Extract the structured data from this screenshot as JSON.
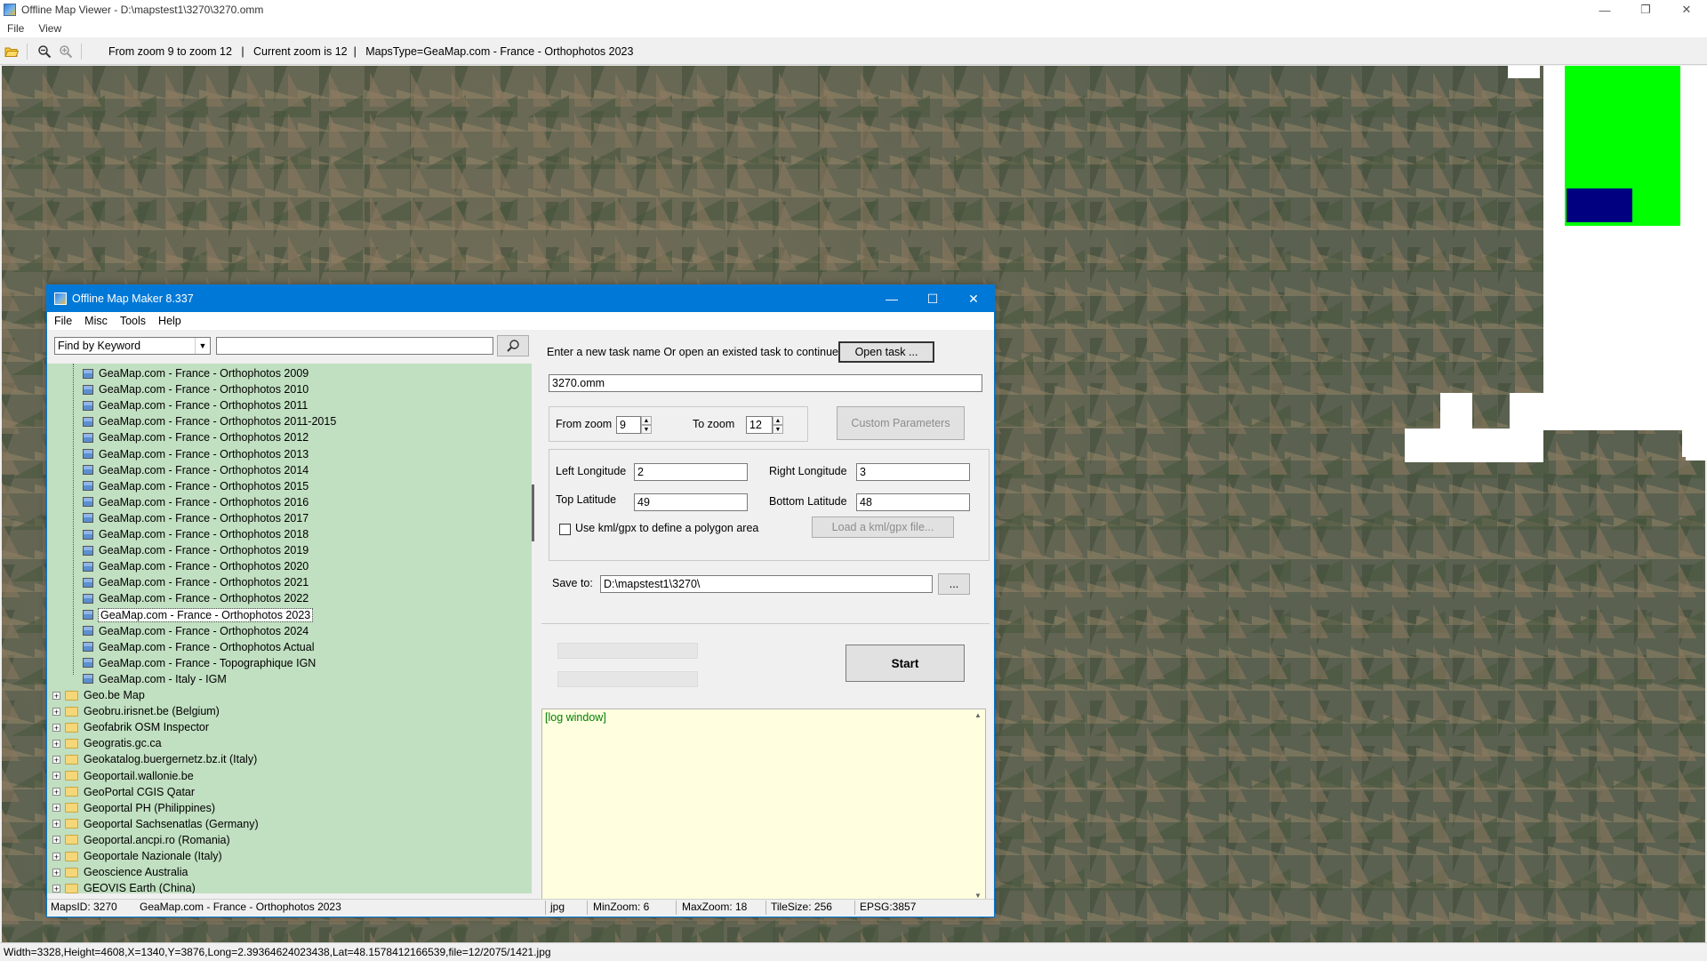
{
  "window": {
    "title": "Offline Map Viewer - D:\\mapstest1\\3270\\3270.omm",
    "controls": [
      "—",
      "❐",
      "✕"
    ]
  },
  "menubar": [
    "File",
    "View"
  ],
  "toolbar": {
    "info": "From zoom 9 to zoom 12   |   Current zoom is 12  |   MapsType=GeaMap.com - France - Orthophotos 2023",
    "icons": [
      "open-folder-icon",
      "zoom-out-icon",
      "zoom-in-icon"
    ]
  },
  "map": {
    "overlay_colors": {
      "tile_white": "#ffffff",
      "green_box": "#00ff00",
      "navy_box": "#000080"
    }
  },
  "status": {
    "text": "Width=3328,Height=4608,X=1340,Y=3876,Long=2.39364624023438,Lat=48.1578412166539,file=12/2075/1421.jpg"
  },
  "dialog": {
    "title": "Offline Map Maker 8.337",
    "menu": [
      "File",
      "Misc",
      "Tools",
      "Help"
    ],
    "search": {
      "mode": "Find by Keyword",
      "query": "",
      "button_icon": "search-icon"
    },
    "tree": {
      "leaves": [
        "GeaMap.com - France - Orthophotos 2009",
        "GeaMap.com - France - Orthophotos 2010",
        "GeaMap.com - France - Orthophotos 2011",
        "GeaMap.com - France - Orthophotos 2011-2015",
        "GeaMap.com - France - Orthophotos 2012",
        "GeaMap.com - France - Orthophotos 2013",
        "GeaMap.com - France - Orthophotos 2014",
        "GeaMap.com - France - Orthophotos 2015",
        "GeaMap.com - France - Orthophotos 2016",
        "GeaMap.com - France - Orthophotos 2017",
        "GeaMap.com - France - Orthophotos 2018",
        "GeaMap.com - France - Orthophotos 2019",
        "GeaMap.com - France - Orthophotos 2020",
        "GeaMap.com - France - Orthophotos 2021",
        "GeaMap.com - France - Orthophotos 2022",
        "GeaMap.com - France - Orthophotos 2023",
        "GeaMap.com - France - Orthophotos 2024",
        "GeaMap.com - France - Orthophotos Actual",
        "GeaMap.com - France - Topographique IGN",
        "GeaMap.com - Italy - IGM"
      ],
      "selected": "GeaMap.com - France - Orthophotos 2023",
      "folders": [
        "Geo.be Map",
        "Geobru.irisnet.be (Belgium)",
        "Geofabrik OSM Inspector",
        "Geogratis.gc.ca",
        "Geokatalog.buergernetz.bz.it (Italy)",
        "Geoportail.wallonie.be",
        "GeoPortal CGIS Qatar",
        "Geoportal PH (Philippines)",
        "Geoportal Sachsenatlas (Germany)",
        "Geoportal.ancpi.ro (Romania)",
        "Geoportale Nazionale (Italy)",
        "Geoscience Australia",
        "GEOVIS Earth (China)"
      ]
    },
    "task": {
      "prompt": "Enter a new task name Or open an existed task to continue:",
      "open_button": "Open task ...",
      "name": "3270.omm"
    },
    "zoom": {
      "from_label": "From zoom",
      "from_value": "9",
      "to_label": "To zoom",
      "to_value": "12",
      "custom_button": "Custom Parameters"
    },
    "bounds": {
      "left_lon_label": "Left Longitude",
      "left_lon": "2",
      "right_lon_label": "Right Longitude",
      "right_lon": "3",
      "top_lat_label": "Top Latitude",
      "top_lat": "49",
      "bottom_lat_label": "Bottom Latitude",
      "bottom_lat": "48",
      "kml_checkbox_label": "Use kml/gpx to define a polygon area",
      "kml_checked": false,
      "load_kml_button": "Load a kml/gpx file..."
    },
    "save": {
      "label": "Save to:",
      "path": "D:\\mapstest1\\3270\\",
      "browse": "..."
    },
    "start_button": "Start",
    "log": "[log window]",
    "statusbar": {
      "maps_id": "MapsID: 3270",
      "maps_name": "GeaMap.com - France - Orthophotos 2023",
      "format": "jpg",
      "min_zoom": "MinZoom: 6",
      "max_zoom": "MaxZoom: 18",
      "tile_size": "TileSize: 256",
      "epsg": "EPSG:3857"
    }
  }
}
